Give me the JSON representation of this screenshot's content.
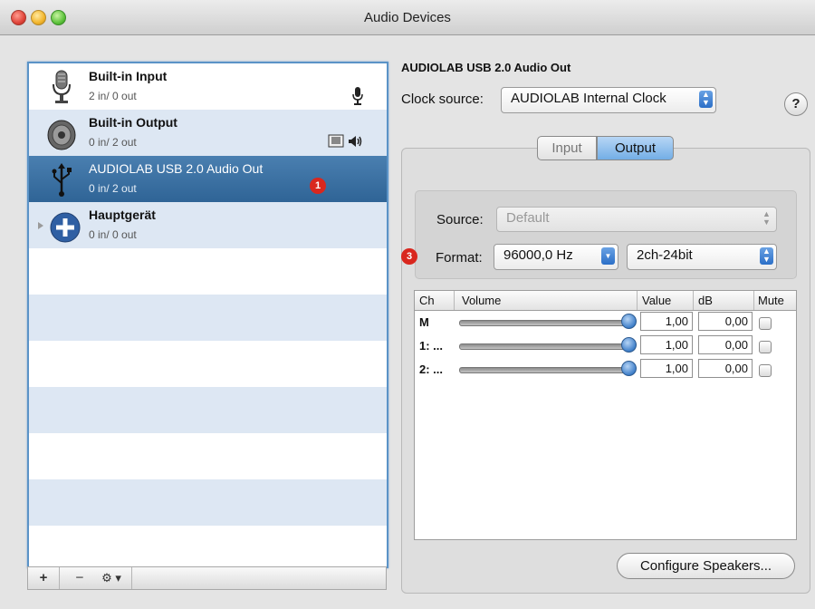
{
  "window": {
    "title": "Audio Devices"
  },
  "devices": [
    {
      "name": "Built-in Input",
      "io": "2 in/ 0 out",
      "icon": "microphone-icon"
    },
    {
      "name": "Built-in Output",
      "io": "0 in/ 2 out",
      "icon": "speaker-icon"
    },
    {
      "name": "AUDIOLAB USB 2.0 Audio Out",
      "io": "0 in/ 2 out",
      "icon": "usb-icon",
      "selected": true,
      "badge": "1"
    },
    {
      "name": "Hauptgerät",
      "io": "0 in/ 0 out",
      "icon": "aggregate-plus-icon"
    }
  ],
  "list_toolbar": {
    "add": "+",
    "remove": "−",
    "gear": "⚙ ▾"
  },
  "panel": {
    "device_title": "AUDIOLAB USB 2.0 Audio Out",
    "clock_label": "Clock source:",
    "clock_value": "AUDIOLAB Internal Clock",
    "help": "?",
    "tabs": [
      "Input",
      "Output"
    ],
    "active_tab": "Output",
    "source_label": "Source:",
    "source_value": "Default",
    "format_badge": "3",
    "format_label": "Format:",
    "format_rate": "96000,0 Hz",
    "format_bits": "2ch-24bit",
    "configure_button": "Configure Speakers..."
  },
  "volume_table": {
    "headers": [
      "Ch",
      "Volume",
      "Value",
      "dB",
      "Mute"
    ],
    "rows": [
      {
        "ch": "M",
        "volume": 1.0,
        "value": "1,00",
        "db": "0,00",
        "mute": false
      },
      {
        "ch": "1: ...",
        "volume": 1.0,
        "value": "1,00",
        "db": "0,00",
        "mute": false
      },
      {
        "ch": "2: ...",
        "volume": 1.0,
        "value": "1,00",
        "db": "0,00",
        "mute": false
      }
    ]
  },
  "colors": {
    "selection": "#3a6fa3",
    "badge_red": "#d9271e",
    "accent_blue": "#2b6fc7"
  }
}
